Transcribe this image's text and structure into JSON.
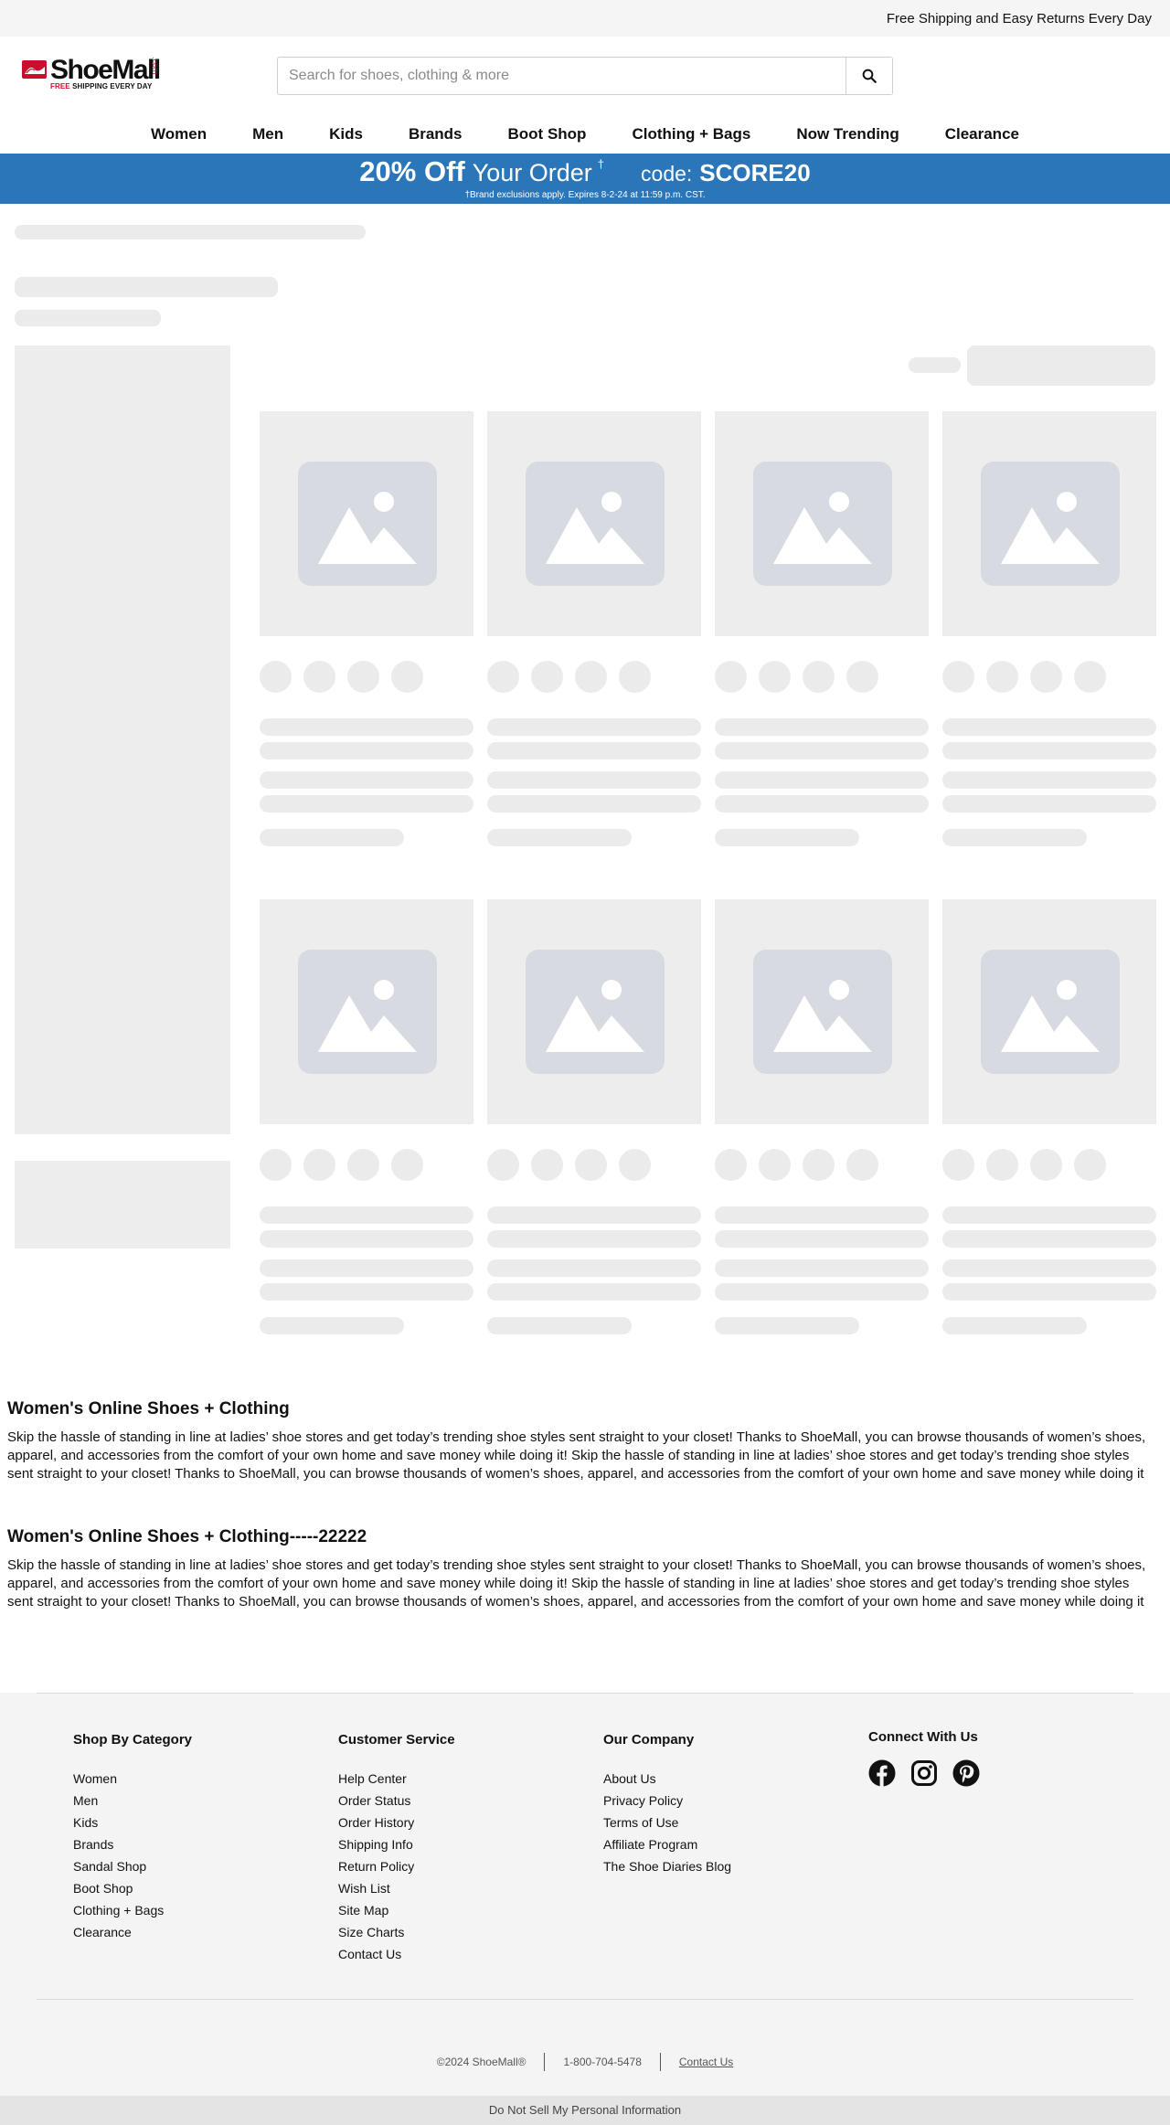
{
  "top_strip": {
    "message": "Free Shipping and Easy Returns Every Day"
  },
  "logo": {
    "word": "ShoeMall",
    "com": ".com",
    "tag_red": "FREE",
    "tag_rest": " SHIPPING EVERY DAY"
  },
  "search": {
    "placeholder": "Search for shoes, clothing & more",
    "value": ""
  },
  "nav": {
    "items": [
      "Women",
      "Men",
      "Kids",
      "Brands",
      "Boot Shop",
      "Clothing + Bags",
      "Now Trending",
      "Clearance"
    ]
  },
  "promo": {
    "headline": "20% Off",
    "your_order": "Your Order",
    "dagger": "†",
    "code_label": "code:",
    "code": "SCORE20",
    "fine_print": "†Brand exclusions apply. Expires 8-2-24 at 11:59 p.m. CST."
  },
  "seo": [
    {
      "title": "Women's Online Shoes + Clothing",
      "body": "Skip the hassle of standing in line at ladies’ shoe stores and get today’s trending shoe styles sent straight to your closet! Thanks to ShoeMall, you can browse thousands of women’s shoes, apparel, and accessories from the comfort of your own home and save money while doing it! Skip the hassle of standing in line at ladies’ shoe stores and get today’s trending shoe styles sent straight to your closet! Thanks to ShoeMall, you can browse thousands of women’s shoes, apparel, and accessories from the comfort of your own home and save money while doing it"
    },
    {
      "title": "Women's Online Shoes + Clothing-----22222",
      "body": "Skip the hassle of standing in line at ladies’ shoe stores and get today’s trending shoe styles sent straight to your closet! Thanks to ShoeMall, you can browse thousands of women’s shoes, apparel, and accessories from the comfort of your own home and save money while doing it! Skip the hassle of standing in line at ladies’ shoe stores and get today’s trending shoe styles sent straight to your closet! Thanks to ShoeMall, you can browse thousands of women’s shoes, apparel, and accessories from the comfort of your own home and save money while doing it"
    }
  ],
  "footer": {
    "shop": {
      "heading": "Shop By Category",
      "links": [
        "Women",
        "Men",
        "Kids",
        "Brands",
        "Sandal Shop",
        "Boot Shop",
        "Clothing + Bags",
        "Clearance"
      ]
    },
    "service": {
      "heading": "Customer Service",
      "links": [
        "Help Center",
        "Order Status",
        "Order History",
        "Shipping Info",
        "Return Policy",
        "Wish List",
        "Site Map",
        "Size Charts",
        "Contact Us"
      ]
    },
    "company": {
      "heading": "Our Company",
      "links": [
        "About Us",
        "Privacy Policy",
        "Terms of Use",
        "Affiliate Program",
        "The Shoe Diaries Blog"
      ]
    },
    "connect": {
      "heading": "Connect With Us",
      "icons": [
        "facebook-icon",
        "instagram-icon",
        "pinterest-icon"
      ]
    },
    "copyright": "©2024 ShoeMall®",
    "phone": "1-800-704-5478",
    "contact": "Contact Us",
    "dns": "Do Not Sell My Personal Information"
  },
  "colors": {
    "promo_bg": "#2a76b8",
    "logo_red": "#c8102e",
    "skeleton": "#ebebeb",
    "placeholder_icon": "#d7dae1"
  }
}
